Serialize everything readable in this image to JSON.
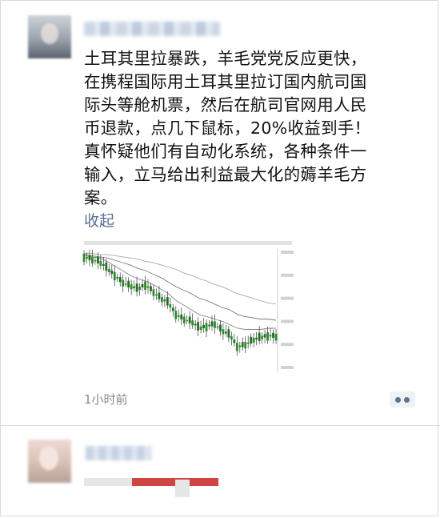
{
  "post": {
    "text": "土耳其里拉暴跌，羊毛党党反应更快，\n在携程国际用土耳其里拉订国内航司国\n际头等舱机票，然后在航司官网用人民\n币退款，点几下鼠标，20%收益到手！\n真怀疑他们有自动化系统，各种条件一\n输入，立马给出利益最大化的薅羊毛方\n案。",
    "collapse_label": "收起",
    "timestamp": "1小时前"
  },
  "chart_data": {
    "type": "line",
    "title": "",
    "xlabel": "",
    "ylabel": "",
    "ylim": [
      0,
      100
    ],
    "x": [
      0,
      4,
      8,
      12,
      16,
      20,
      24,
      28,
      32,
      36,
      40,
      44,
      48,
      52,
      56,
      60,
      64,
      68,
      72,
      76,
      80,
      84,
      88,
      92,
      96,
      100
    ],
    "series": [
      {
        "values": [
          96,
          94,
          92,
          86,
          80,
          74,
          71,
          68,
          72,
          66,
          60,
          56,
          46,
          42,
          40,
          34,
          36,
          38,
          32,
          28,
          18,
          20,
          24,
          26,
          28,
          27
        ]
      },
      {
        "values": [
          97,
          96,
          95,
          92,
          88,
          84,
          80,
          77,
          75,
          72,
          68,
          64,
          58,
          54,
          50,
          46,
          44,
          42,
          40,
          37,
          34,
          33,
          33,
          33,
          34,
          34
        ]
      },
      {
        "values": [
          98,
          97,
          96,
          95,
          93,
          91,
          89,
          86,
          84,
          81,
          78,
          74,
          70,
          67,
          64,
          60,
          58,
          55,
          52,
          50,
          46,
          44,
          43,
          42,
          42,
          41
        ]
      },
      {
        "values": [
          99,
          99,
          98,
          98,
          97,
          96,
          95,
          94,
          92,
          91,
          89,
          87,
          85,
          82,
          80,
          77,
          75,
          72,
          70,
          67,
          64,
          62,
          60,
          58,
          56,
          55
        ]
      }
    ]
  },
  "colors": {
    "link": "#5a6f91",
    "text": "#111111",
    "timestamp": "#8a8a8a",
    "candle_up": "#2e8b2e",
    "candle_down": "#1f6f1f"
  },
  "icons": {
    "more": "ellipsis-comment-icon"
  }
}
